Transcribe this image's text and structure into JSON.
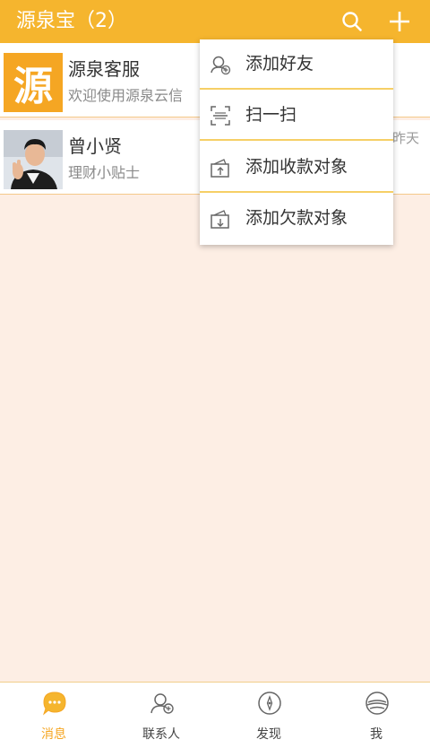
{
  "header": {
    "title": "源泉宝（2）",
    "search_icon": "search-icon",
    "add_icon": "plus-icon",
    "background": "#f5b52e"
  },
  "conversations": [
    {
      "name": "源泉客服",
      "preview": "欢迎使用源泉云信",
      "avatar_text": "源",
      "avatar": "logo"
    },
    {
      "name": "曾小贤",
      "preview": "理财小贴士",
      "time": "昨天",
      "avatar": "photo"
    }
  ],
  "menu": {
    "items": [
      {
        "label": "添加好友",
        "icon": "add-friend-icon"
      },
      {
        "label": "扫一扫",
        "icon": "scan-icon"
      },
      {
        "label": "添加收款对象",
        "icon": "add-payee-icon"
      },
      {
        "label": "添加欠款对象",
        "icon": "add-debtor-icon"
      }
    ]
  },
  "tabs": [
    {
      "label": "消息",
      "icon": "message-icon",
      "active": true
    },
    {
      "label": "联系人",
      "icon": "contacts-icon",
      "active": false
    },
    {
      "label": "发现",
      "icon": "compass-icon",
      "active": false
    },
    {
      "label": "我",
      "icon": "profile-icon",
      "active": false
    }
  ],
  "colors": {
    "accent": "#f5a623",
    "header": "#f5b52e",
    "content_bg": "#fdeee4"
  }
}
